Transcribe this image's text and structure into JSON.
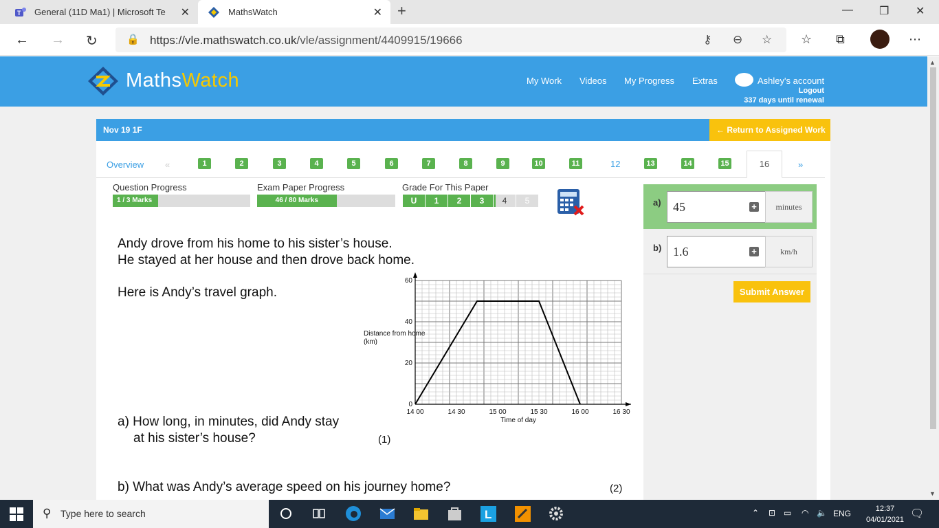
{
  "browser": {
    "tabs": [
      {
        "label": "General (11D Ma1) | Microsoft Te"
      },
      {
        "label": "MathsWatch"
      }
    ],
    "url_host": "https://vle.mathswatch.co.uk",
    "url_path": "/vle/assignment/4409915/19666"
  },
  "site": {
    "logo_part1": "Maths",
    "logo_part2": "Watch",
    "nav": [
      "My Work",
      "Videos",
      "My Progress",
      "Extras"
    ],
    "account": "Ashley's account",
    "logout": "Logout",
    "renewal": "337 days until renewal"
  },
  "paper": {
    "title": "Nov 19 1F",
    "return_label": "Return to Assigned Work",
    "overview": "Overview",
    "prev": "«",
    "next": "»",
    "questions": [
      "1",
      "2",
      "3",
      "4",
      "5",
      "6",
      "7",
      "8",
      "9",
      "10",
      "11",
      "12",
      "13",
      "14",
      "15"
    ],
    "current": "16"
  },
  "progress": {
    "question_label": "Question Progress",
    "question_value": "1 / 3 Marks",
    "question_fraction": 0.33,
    "exam_label": "Exam Paper Progress",
    "exam_value": "46 / 80 Marks",
    "exam_fraction": 0.575,
    "grade_label": "Grade For This Paper",
    "grades": [
      "U",
      "1",
      "2",
      "3",
      "4",
      "5"
    ]
  },
  "question": {
    "line1": "Andy drove from his home to his sister’s house.",
    "line2": "He stayed at her house and then drove back home.",
    "line3": "Here is Andy’s travel graph.",
    "qa_1": "a) How long, in minutes, did Andy stay",
    "qa_2": "at his sister’s house?",
    "qa_marks": "(1)",
    "qb": "b) What was Andy’s average speed on his journey home?",
    "qb_marks": "(2)"
  },
  "chart_data": {
    "type": "line",
    "xlabel": "Time of day",
    "ylabel": "Distance from home (km)",
    "x_ticks": [
      "14 00",
      "14 30",
      "15 00",
      "15 30",
      "16 00",
      "16 30"
    ],
    "y_ticks": [
      "0",
      "20",
      "40",
      "60"
    ],
    "ylim": [
      0,
      60
    ],
    "xlim_minutes": [
      0,
      150
    ],
    "points": [
      {
        "x": "14 00",
        "y": 0
      },
      {
        "x": "14 45",
        "y": 50
      },
      {
        "x": "15 30",
        "y": 50
      },
      {
        "x": "16 00",
        "y": 0
      }
    ],
    "grid": true
  },
  "answers": {
    "a_label": "a)",
    "a_value": "45",
    "a_unit": "minutes",
    "b_label": "b)",
    "b_value": "1.6",
    "b_unit": "km/h",
    "submit": "Submit Answer"
  },
  "taskbar": {
    "search_placeholder": "Type here to search",
    "lang": "ENG",
    "time": "12:37",
    "date": "04/01/2021"
  }
}
